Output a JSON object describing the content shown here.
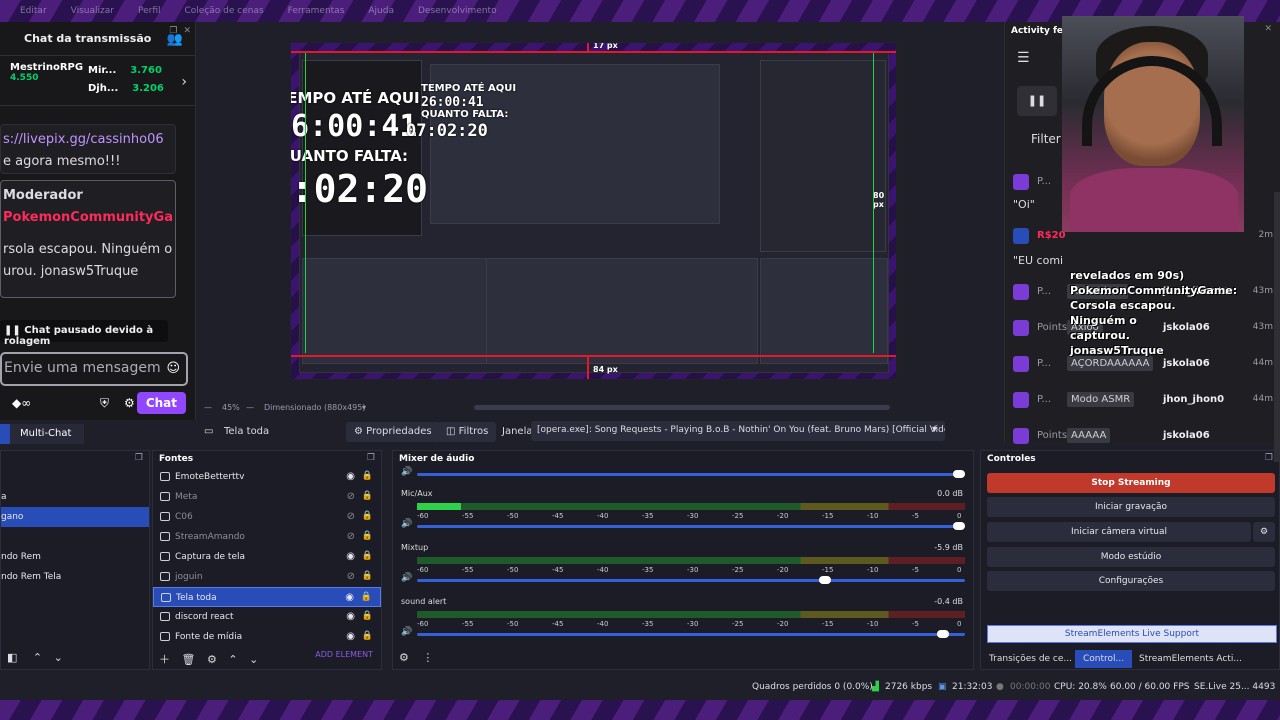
{
  "top_menu": [
    "Editar",
    "Visualizar",
    "Perfil",
    "Coleção de cenas",
    "Ferramentas",
    "Ajuda",
    "Desenvolvimento"
  ],
  "chat": {
    "title": "Chat da transmissão",
    "leaderboard": {
      "first_name": "MestrinoRPG",
      "first_value": "4.550",
      "second_name": "Mir...",
      "second_value": "3.760",
      "third_name": "Djh...",
      "third_value": "3.206"
    },
    "msg1_link": "s://livepix.gg/cassinho06",
    "msg1_text": "e agora mesmo!!!",
    "mod_title": "Moderador",
    "mod_user": "PokemonCommunityGa",
    "mod_text_1": "rsola escapou. Ninguém o",
    "mod_text_2": "urou. jonasw5Truque",
    "paused": "Chat pausado devido à rolagem",
    "placeholder": "Envie uma mensagem",
    "send": "Chat"
  },
  "preview": {
    "timer_label_1": "TEMPO ATÉ AQUI",
    "timer_value_1": "26:00:41",
    "timer_label_2": "QUANTO FALTA:",
    "timer_value_2": "07:02:20",
    "top_guide": "17 px",
    "bottom_guide": "84 px",
    "right_guide": "80 px",
    "mini_timer_1": "26:00:41",
    "mini_timer_2": "07:02:20",
    "mini_label": "QUANTO FALTA:",
    "mini_label2": "TEMPO ATÉ AQUI",
    "zoom": "45%",
    "scale_label": "Dimensionado (880x495)"
  },
  "toolbar": {
    "multichat": "Multi-Chat",
    "source_name": "Tela toda",
    "properties": "Propriedades",
    "filters": "Filtros",
    "window_label": "Janela",
    "window_value": "[opera.exe]: Song Requests - Playing B.o.B - Nothin' On You (feat. Bruno Mars) [Official Video] -"
  },
  "scenes": {
    "items": [
      "a",
      "gano",
      "",
      "ndo Rem",
      "ndo Rem Tela"
    ]
  },
  "sources": {
    "title": "Fontes",
    "items": [
      {
        "name": "EmoteBetterttv",
        "dim": false
      },
      {
        "name": "Meta",
        "dim": true
      },
      {
        "name": "C06",
        "dim": true
      },
      {
        "name": "StreamAmando",
        "dim": true
      },
      {
        "name": "Captura de tela",
        "dim": false
      },
      {
        "name": "joguin",
        "dim": true
      },
      {
        "name": "Tela toda",
        "dim": false
      },
      {
        "name": "discord react",
        "dim": false
      },
      {
        "name": "Fonte de mídia",
        "dim": false
      }
    ],
    "add": "ADD ELEMENT"
  },
  "mixer": {
    "title": "Mixer de áudio",
    "scale": [
      "-60",
      "-55",
      "-50",
      "-45",
      "-40",
      "-35",
      "-30",
      "-25",
      "-20",
      "-15",
      "-10",
      "-5",
      "0"
    ],
    "channels": [
      {
        "name": "Mic/Aux",
        "db": "0.0 dB",
        "level": 0.08,
        "volume": 1.0
      },
      {
        "name": "Mixtup",
        "db": "-5.9 dB",
        "level": 0.0,
        "volume": 0.75
      },
      {
        "name": "sound alert",
        "db": "-0.4 dB",
        "level": 0.0,
        "volume": 0.97
      }
    ]
  },
  "controls": {
    "title": "Controles",
    "stop": "Stop Streaming",
    "record": "Iniciar gravação",
    "virtualcam": "Iniciar câmera virtual",
    "studio": "Modo estúdio",
    "settings": "Configurações",
    "se_support": "StreamElements Live Support",
    "tab_transitions": "Transições de ce...",
    "tab_controls": "Control...",
    "tab_se": "StreamElements Acti..."
  },
  "status": {
    "dropped": "Quadros perdidos 0 (0.0%)",
    "kbps": "2726 kbps",
    "live_time": "21:32:03",
    "rec_time": "00:00:00",
    "cpu": "CPU: 20.8%",
    "fps": "60.00 / 60.00 FPS",
    "se_live": "SE.Live 25... 4493"
  },
  "feed": {
    "title": "Activity feed",
    "filter": "Filter",
    "oi": "\"Oi\"",
    "rs": "R$20",
    "eu": "\"EU comi",
    "rows": [
      {
        "type": "P...",
        "chip": "Atumalaca",
        "user": "jhon_jhon00",
        "time": "43m"
      },
      {
        "type": "Points",
        "chip": "Axioo",
        "user": "jskola06",
        "time": "43m"
      },
      {
        "type": "P...",
        "chip": "AÇORDAAAAAA",
        "user": "jskola06",
        "time": "44m"
      },
      {
        "type": "P...",
        "chip": "Modo ASMR",
        "user": "jhon_jhon0",
        "time": "44m"
      },
      {
        "type": "Points",
        "chip": "AAAAA",
        "user": "jskola06",
        "time": ""
      }
    ],
    "times_top": [
      "2m",
      "2m"
    ],
    "caption": "revelados em 90s) PokemonCommunityGame: Corsola escapou. Ninguém o capturou. jonasw5Truque"
  }
}
